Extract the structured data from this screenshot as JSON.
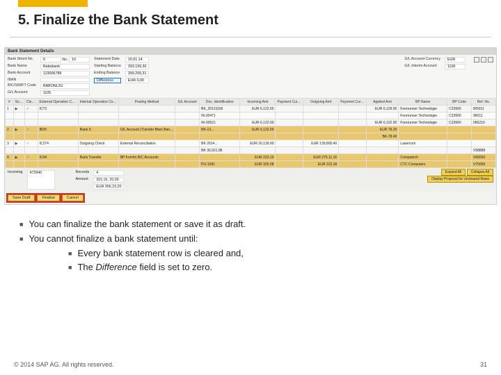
{
  "title": "5. Finalize the Bank Statement",
  "panel": {
    "title": "Bank Statement Details",
    "header": {
      "left": {
        "bank_stmt_no_lbl": "Bank Stmnt No.",
        "bank_stmt_no_val": "0",
        "no_lbl": "No.",
        "no_val": "10",
        "bank_name_lbl": "Bank Name",
        "bank_name_val": "Rabobank",
        "stmt_date_lbl": "Statement Date",
        "stmt_date_val": "15.01.14",
        "bank_account_lbl": "Bank Account",
        "bank_account_val": "123006789",
        "start_bal_lbl": "Starting Balance",
        "start_bal_val": "393.199,30",
        "iban_lbl": "IBAN",
        "iban_val": "",
        "end_bal_lbl": "Ending Balance",
        "end_bal_val": "399.299,31",
        "swift_lbl": "BIC/SWIFT Code",
        "swift_val": "RABONL2U",
        "diff_lbl": "Difference",
        "diff_val": "EUR 0,00",
        "gl_lbl": "G/L Account",
        "gl_val": "1105"
      },
      "right": {
        "gl_cur_lbl": "G/L Account Currency",
        "gl_cur_val": "EUR",
        "gl_int_lbl": "G/L Interim Account",
        "gl_int_val": "1106"
      }
    },
    "columns": [
      "#",
      "Source",
      "Cleared",
      "External Operation Code",
      "Internal Operation Code",
      "Posting Method",
      "G/L Account",
      "Doc. Identification",
      "Incoming Amt",
      "Payment Currency",
      "Outgoing Amt",
      "Payment Currency",
      "Applied Amt",
      "BP Name",
      "BP Code",
      "Ref. No."
    ],
    "rows": [
      {
        "n": "1",
        "sel": false,
        "cleared": true,
        "eoc": "IC73",
        "ioc": "",
        "pm": "",
        "gl": "",
        "doc": "BK_20131166",
        "in": "EUR 6,122.00",
        "pc1": "",
        "out": "",
        "pc2": "",
        "app": "EUR 6,129.00",
        "bp": "Forerunner Technologie",
        "bpc": "C23900",
        "ref": "IR5011"
      },
      {
        "n": "",
        "sel": false,
        "cleared": false,
        "eoc": "",
        "ioc": "",
        "pm": "",
        "gl": "",
        "doc": "IN-30471",
        "in": "",
        "pc1": "",
        "out": "",
        "pc2": "",
        "app": "",
        "bp": "Forerunner Technologie",
        "bpc": "C23900",
        "ref": "96011"
      },
      {
        "n": "",
        "sel": false,
        "cleared": false,
        "eoc": "",
        "ioc": "",
        "pm": "",
        "gl": "",
        "doc": "IN-30521",
        "in": "EUR 6,122.00",
        "pc1": "",
        "out": "",
        "pc2": "",
        "app": "EUR 6,122.00",
        "bp": "Forerunner Technologie",
        "bpc": "C23900",
        "ref": "056210"
      },
      {
        "n": "2",
        "sel": true,
        "cleared": true,
        "eoc": "IB29",
        "ioc": "Bank S",
        "pm": "G/L Account (Transfer Btwn Bank Account)",
        "gl": "",
        "doc": "BK-13...",
        "in": "EUR 6,122.00",
        "pc1": "",
        "out": "",
        "pc2": "",
        "app": "EUR 78,29",
        "bp": "",
        "bpc": "",
        "ref": ""
      },
      {
        "n": "",
        "sel": true,
        "cleared": false,
        "eoc": "",
        "ioc": "",
        "pm": "",
        "gl": "",
        "doc": "",
        "in": "",
        "pc1": "",
        "out": "",
        "pc2": "",
        "app": "BK-78.49",
        "bp": "",
        "bpc": "",
        "ref": ""
      },
      {
        "n": "3",
        "sel": false,
        "cleared": true,
        "eoc": "IC274",
        "ioc": "Outgoing Check",
        "pm": "External Reconciliation",
        "gl": "",
        "doc": "BK 2014...",
        "in": "EUR 20,139.99",
        "pc1": "",
        "out": "EUR 139,800,40",
        "pc2": "",
        "app": "",
        "bp": "Lasercom",
        "bpc": "",
        "ref": ""
      },
      {
        "n": "",
        "sel": false,
        "cleared": false,
        "eoc": "",
        "ioc": "",
        "pm": "",
        "gl": "",
        "doc": "BK 30,931,98",
        "in": "",
        "pc1": "",
        "out": "",
        "pc2": "",
        "app": "",
        "bp": "",
        "bpc": "",
        "ref": "V58888"
      },
      {
        "n": "4",
        "sel": true,
        "cleared": true,
        "eoc": "IC44",
        "ioc": "Bank Transfer",
        "pm": "BP from/to B/C Accounts",
        "gl": "",
        "doc": "",
        "in": "EUR 223.15",
        "pc1": "",
        "out": "EUR 275.11,16",
        "pc2": "",
        "app": "",
        "bp": "Computech",
        "bpc": "",
        "ref": "V66000"
      },
      {
        "n": "",
        "sel": true,
        "cleared": false,
        "eoc": "",
        "ioc": "",
        "pm": "",
        "gl": "",
        "doc": "PU-1081",
        "in": "EUR 325.08",
        "pc1": "",
        "out": "EUR 222,18",
        "pc2": "",
        "app": "",
        "bp": "CTC Computers",
        "bpc": "",
        "ref": "V70000"
      }
    ],
    "footer": {
      "incoming_lbl": "Incoming",
      "incoming_val": "473940",
      "records_lbl": "Records",
      "records_val": "4",
      "amount_lbl": "Amount",
      "amount_val1": "315,16, 20,00",
      "amount_val2": "EUR 356,23,20"
    },
    "yellow": {
      "expand": "Expand All",
      "collapse": "Collapse All",
      "proposal": "Display Proposal for Uncleared Rows"
    },
    "actions": {
      "save": "Save Draft",
      "finalize": "Finalize",
      "cancel": "Cancel"
    }
  },
  "bullets": {
    "b1": "You can finalize the bank statement or save it as draft.",
    "b2": "You cannot finalize a bank statement until:",
    "s1": "Every bank statement row is cleared and,",
    "s2_pre": "The ",
    "s2_em": "Difference",
    "s2_post": " field is set to zero."
  },
  "footer": {
    "copyright": "© 2014 SAP AG. All rights reserved.",
    "page": "31"
  }
}
